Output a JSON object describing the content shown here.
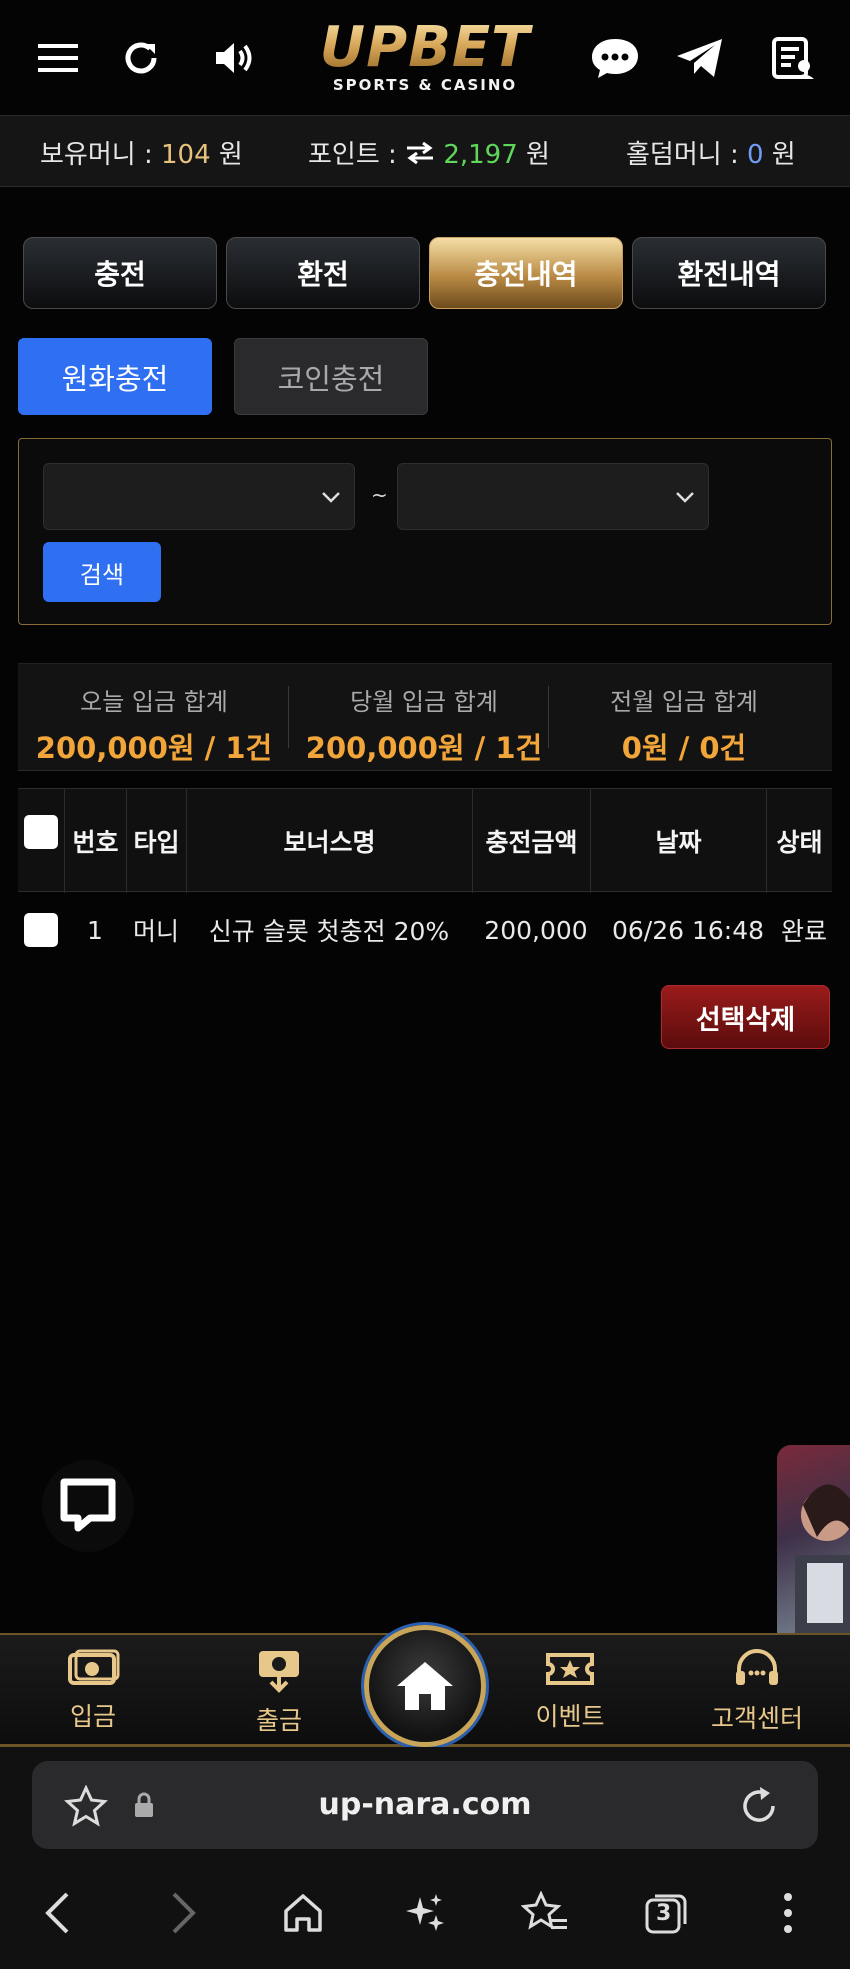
{
  "header": {
    "logo_main": "UPBET",
    "logo_sub": "SPORTS & CASINO",
    "icons": [
      "menu-icon",
      "refresh-icon",
      "sound-icon",
      "chat-icon",
      "telegram-icon",
      "notes-icon"
    ]
  },
  "balance": {
    "money_label": "보유머니 :",
    "money_value": "104",
    "money_unit": "원",
    "point_label": "포인트 :",
    "point_value": "2,197",
    "point_unit": "원",
    "holdem_label": "홀덤머니 :",
    "holdem_value": "0",
    "holdem_unit": "원"
  },
  "tabs": [
    {
      "label": "충전"
    },
    {
      "label": "환전"
    },
    {
      "label": "충전내역"
    },
    {
      "label": "환전내역"
    }
  ],
  "subtabs": [
    {
      "label": "원화충전"
    },
    {
      "label": "코인충전"
    }
  ],
  "search": {
    "tilde": "~",
    "button": "검색"
  },
  "summary": [
    {
      "label": "오늘 입금 합계",
      "value": "200,000원 / 1건"
    },
    {
      "label": "당월 입금 합계",
      "value": "200,000원 / 1건"
    },
    {
      "label": "전월 입금 합계",
      "value": "0원 / 0건"
    }
  ],
  "table": {
    "headers": [
      "번호",
      "타입",
      "보너스명",
      "충전금액",
      "날짜",
      "상태"
    ],
    "rows": [
      {
        "no": "1",
        "type": "머니",
        "bonus": "신규 슬롯 첫충전 20%",
        "amount": "200,000",
        "date": "06/26 16:48",
        "status": "완료"
      }
    ]
  },
  "delete_button": "선택삭제",
  "bottom_nav": [
    {
      "label": "입금"
    },
    {
      "label": "출금"
    },
    {
      "label": "이벤트"
    },
    {
      "label": "고객센터"
    }
  ],
  "browser": {
    "url": "up-nara.com",
    "tab_count": "3"
  },
  "colors": {
    "gold": "#e8c17b",
    "green": "#5ed75a",
    "blue": "#2f6ff2",
    "orange": "#f2a63a",
    "red": "#8a1616"
  }
}
